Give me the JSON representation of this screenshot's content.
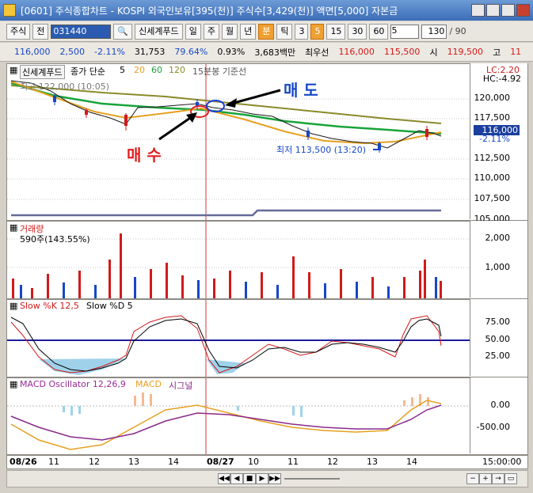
{
  "window": {
    "title": "[0601] 주식종합차트 - KOSPI 외국인보유[395(천)] 주식수[3,429(천)] 액면[5,000] 자본금"
  },
  "toolbar": {
    "type": "주식",
    "code_label": "전",
    "code_value": "031440",
    "stock_name": "신세계푸드",
    "periods": [
      "일",
      "주",
      "월",
      "년",
      "분",
      "틱"
    ],
    "active_period": "분",
    "minutes": [
      "3",
      "5",
      "15",
      "30",
      "60"
    ],
    "active_minute": "5",
    "fractions": [
      "½",
      "½",
      "½"
    ],
    "interval": "5",
    "count": "130",
    "count_total": "/ 90"
  },
  "quote": {
    "price": "116,000",
    "change": "2,500",
    "change_pct": "-2.11%",
    "volume": "31,753",
    "ratio1": "79.64%",
    "ratio2": "0.93%",
    "amount": "3,683백만",
    "best_label": "최우선",
    "best_ask": "116,000",
    "best_bid": "115,500",
    "open_label": "시",
    "open": "119,500",
    "high_label": "고",
    "high": "11"
  },
  "price_panel": {
    "title": "신세계푸드",
    "ma_label": "종가 단순",
    "ma": [
      "5",
      "20",
      "60",
      "120"
    ],
    "ma_colors": [
      "#1a1a1a",
      "#e6a020",
      "#19a43a",
      "#8a8a2a"
    ],
    "basis": "15분봉 기준선",
    "high_note": "최고 122,000 (10:05)",
    "low_note": "최저 113,500 (13:20)",
    "lc": "LC:2.20",
    "hc": "HC:-4.92",
    "current": "116,000",
    "current_pct": "-2.11%",
    "y_ticks": [
      "120,000",
      "117,500",
      "115,000",
      "112,500",
      "110,000",
      "107,500",
      "105,000"
    ]
  },
  "annotations": {
    "sell": "매 도",
    "buy": "매 수"
  },
  "volume_panel": {
    "title": "거래량",
    "info": "590주(143.55%)",
    "y_ticks": [
      "2,000",
      "1,000"
    ]
  },
  "stoch_panel": {
    "k_label": "Slow %K 12,5",
    "d_label": "Slow %D 5",
    "y_ticks": [
      "75.00",
      "50.00",
      "25.00"
    ]
  },
  "macd_panel": {
    "osc_label": "MACD Oscillator 12,26,9",
    "macd_label": "MACD",
    "signal_label": "시그널",
    "y_ticks": [
      "0.00",
      "-500.00"
    ]
  },
  "time_axis": {
    "labels": [
      "08/26",
      "11",
      "12",
      "13",
      "14",
      "08/27",
      "10",
      "11",
      "12",
      "13",
      "14"
    ],
    "corner": "15:00:00"
  }
}
